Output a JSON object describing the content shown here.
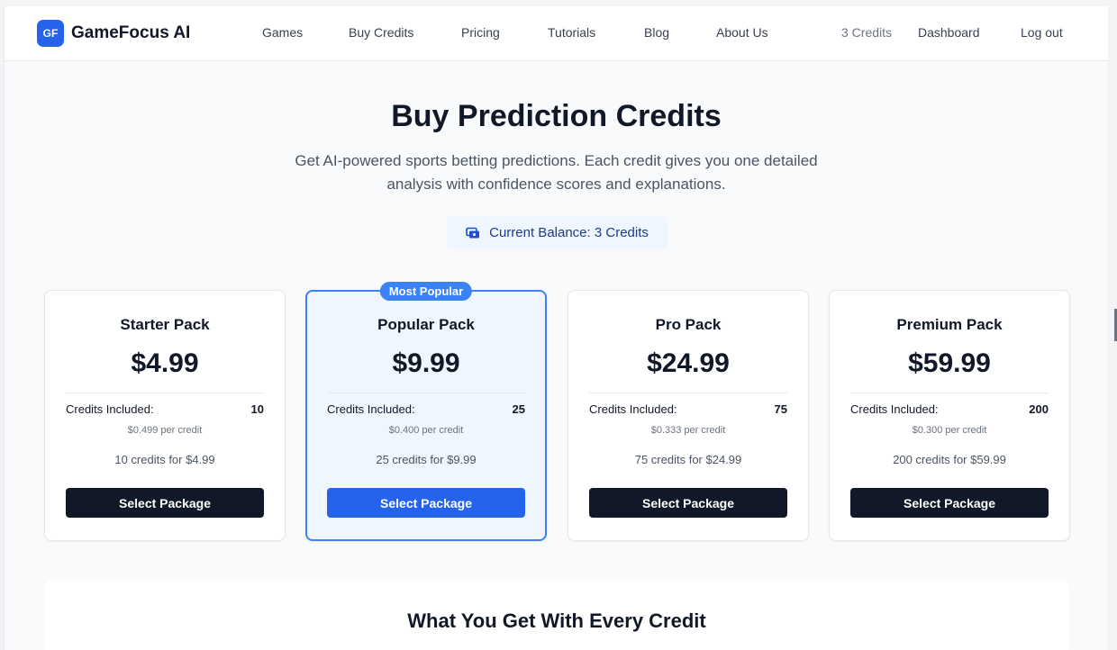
{
  "header": {
    "logo_badge": "GF",
    "logo_text": "GameFocus AI",
    "nav": [
      "Games",
      "Buy Credits",
      "Pricing",
      "Tutorials",
      "Blog",
      "About Us"
    ],
    "credits": "3 Credits",
    "dashboard": "Dashboard",
    "logout": "Log out"
  },
  "hero": {
    "title": "Buy Prediction Credits",
    "subtitle": "Get AI-powered sports betting predictions. Each credit gives you one detailed analysis with confidence scores and explanations.",
    "balance": "Current Balance: 3 Credits"
  },
  "packages": [
    {
      "name": "Starter Pack",
      "price": "$4.99",
      "credits_label": "Credits Included:",
      "credits": "10",
      "per_credit": "$0.499 per credit",
      "summary": "10 credits for $4.99",
      "button": "Select Package"
    },
    {
      "name": "Popular Pack",
      "price": "$9.99",
      "credits_label": "Credits Included:",
      "credits": "25",
      "per_credit": "$0.400 per credit",
      "summary": "25 credits for $9.99",
      "button": "Select Package",
      "badge": "Most Popular"
    },
    {
      "name": "Pro Pack",
      "price": "$24.99",
      "credits_label": "Credits Included:",
      "credits": "75",
      "per_credit": "$0.333 per credit",
      "summary": "75 credits for $24.99",
      "button": "Select Package"
    },
    {
      "name": "Premium Pack",
      "price": "$59.99",
      "credits_label": "Credits Included:",
      "credits": "200",
      "per_credit": "$0.300 per credit",
      "summary": "200 credits for $59.99",
      "button": "Select Package"
    }
  ],
  "features": {
    "title": "What You Get With Every Credit"
  },
  "icons": {
    "balance": "wallet-icon"
  },
  "colors": {
    "accent": "#2563eb",
    "dark_button": "#111827",
    "featured_bg": "#eff6ff"
  }
}
